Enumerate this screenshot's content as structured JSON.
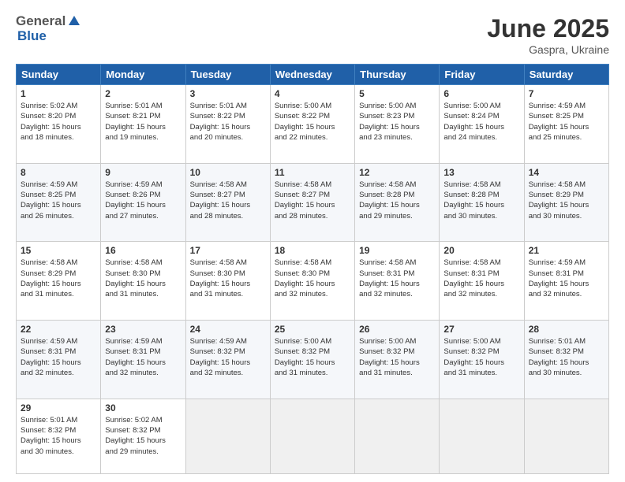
{
  "header": {
    "logo_general": "General",
    "logo_blue": "Blue",
    "month_title": "June 2025",
    "subtitle": "Gaspra, Ukraine"
  },
  "days_of_week": [
    "Sunday",
    "Monday",
    "Tuesday",
    "Wednesday",
    "Thursday",
    "Friday",
    "Saturday"
  ],
  "weeks": [
    [
      {
        "day": "1",
        "lines": [
          "Sunrise: 5:02 AM",
          "Sunset: 8:20 PM",
          "Daylight: 15 hours",
          "and 18 minutes."
        ]
      },
      {
        "day": "2",
        "lines": [
          "Sunrise: 5:01 AM",
          "Sunset: 8:21 PM",
          "Daylight: 15 hours",
          "and 19 minutes."
        ]
      },
      {
        "day": "3",
        "lines": [
          "Sunrise: 5:01 AM",
          "Sunset: 8:22 PM",
          "Daylight: 15 hours",
          "and 20 minutes."
        ]
      },
      {
        "day": "4",
        "lines": [
          "Sunrise: 5:00 AM",
          "Sunset: 8:22 PM",
          "Daylight: 15 hours",
          "and 22 minutes."
        ]
      },
      {
        "day": "5",
        "lines": [
          "Sunrise: 5:00 AM",
          "Sunset: 8:23 PM",
          "Daylight: 15 hours",
          "and 23 minutes."
        ]
      },
      {
        "day": "6",
        "lines": [
          "Sunrise: 5:00 AM",
          "Sunset: 8:24 PM",
          "Daylight: 15 hours",
          "and 24 minutes."
        ]
      },
      {
        "day": "7",
        "lines": [
          "Sunrise: 4:59 AM",
          "Sunset: 8:25 PM",
          "Daylight: 15 hours",
          "and 25 minutes."
        ]
      }
    ],
    [
      {
        "day": "8",
        "lines": [
          "Sunrise: 4:59 AM",
          "Sunset: 8:25 PM",
          "Daylight: 15 hours",
          "and 26 minutes."
        ]
      },
      {
        "day": "9",
        "lines": [
          "Sunrise: 4:59 AM",
          "Sunset: 8:26 PM",
          "Daylight: 15 hours",
          "and 27 minutes."
        ]
      },
      {
        "day": "10",
        "lines": [
          "Sunrise: 4:58 AM",
          "Sunset: 8:27 PM",
          "Daylight: 15 hours",
          "and 28 minutes."
        ]
      },
      {
        "day": "11",
        "lines": [
          "Sunrise: 4:58 AM",
          "Sunset: 8:27 PM",
          "Daylight: 15 hours",
          "and 28 minutes."
        ]
      },
      {
        "day": "12",
        "lines": [
          "Sunrise: 4:58 AM",
          "Sunset: 8:28 PM",
          "Daylight: 15 hours",
          "and 29 minutes."
        ]
      },
      {
        "day": "13",
        "lines": [
          "Sunrise: 4:58 AM",
          "Sunset: 8:28 PM",
          "Daylight: 15 hours",
          "and 30 minutes."
        ]
      },
      {
        "day": "14",
        "lines": [
          "Sunrise: 4:58 AM",
          "Sunset: 8:29 PM",
          "Daylight: 15 hours",
          "and 30 minutes."
        ]
      }
    ],
    [
      {
        "day": "15",
        "lines": [
          "Sunrise: 4:58 AM",
          "Sunset: 8:29 PM",
          "Daylight: 15 hours",
          "and 31 minutes."
        ]
      },
      {
        "day": "16",
        "lines": [
          "Sunrise: 4:58 AM",
          "Sunset: 8:30 PM",
          "Daylight: 15 hours",
          "and 31 minutes."
        ]
      },
      {
        "day": "17",
        "lines": [
          "Sunrise: 4:58 AM",
          "Sunset: 8:30 PM",
          "Daylight: 15 hours",
          "and 31 minutes."
        ]
      },
      {
        "day": "18",
        "lines": [
          "Sunrise: 4:58 AM",
          "Sunset: 8:30 PM",
          "Daylight: 15 hours",
          "and 32 minutes."
        ]
      },
      {
        "day": "19",
        "lines": [
          "Sunrise: 4:58 AM",
          "Sunset: 8:31 PM",
          "Daylight: 15 hours",
          "and 32 minutes."
        ]
      },
      {
        "day": "20",
        "lines": [
          "Sunrise: 4:58 AM",
          "Sunset: 8:31 PM",
          "Daylight: 15 hours",
          "and 32 minutes."
        ]
      },
      {
        "day": "21",
        "lines": [
          "Sunrise: 4:59 AM",
          "Sunset: 8:31 PM",
          "Daylight: 15 hours",
          "and 32 minutes."
        ]
      }
    ],
    [
      {
        "day": "22",
        "lines": [
          "Sunrise: 4:59 AM",
          "Sunset: 8:31 PM",
          "Daylight: 15 hours",
          "and 32 minutes."
        ]
      },
      {
        "day": "23",
        "lines": [
          "Sunrise: 4:59 AM",
          "Sunset: 8:31 PM",
          "Daylight: 15 hours",
          "and 32 minutes."
        ]
      },
      {
        "day": "24",
        "lines": [
          "Sunrise: 4:59 AM",
          "Sunset: 8:32 PM",
          "Daylight: 15 hours",
          "and 32 minutes."
        ]
      },
      {
        "day": "25",
        "lines": [
          "Sunrise: 5:00 AM",
          "Sunset: 8:32 PM",
          "Daylight: 15 hours",
          "and 31 minutes."
        ]
      },
      {
        "day": "26",
        "lines": [
          "Sunrise: 5:00 AM",
          "Sunset: 8:32 PM",
          "Daylight: 15 hours",
          "and 31 minutes."
        ]
      },
      {
        "day": "27",
        "lines": [
          "Sunrise: 5:00 AM",
          "Sunset: 8:32 PM",
          "Daylight: 15 hours",
          "and 31 minutes."
        ]
      },
      {
        "day": "28",
        "lines": [
          "Sunrise: 5:01 AM",
          "Sunset: 8:32 PM",
          "Daylight: 15 hours",
          "and 30 minutes."
        ]
      }
    ],
    [
      {
        "day": "29",
        "lines": [
          "Sunrise: 5:01 AM",
          "Sunset: 8:32 PM",
          "Daylight: 15 hours",
          "and 30 minutes."
        ]
      },
      {
        "day": "30",
        "lines": [
          "Sunrise: 5:02 AM",
          "Sunset: 8:32 PM",
          "Daylight: 15 hours",
          "and 29 minutes."
        ]
      },
      {
        "day": "",
        "lines": []
      },
      {
        "day": "",
        "lines": []
      },
      {
        "day": "",
        "lines": []
      },
      {
        "day": "",
        "lines": []
      },
      {
        "day": "",
        "lines": []
      }
    ]
  ]
}
